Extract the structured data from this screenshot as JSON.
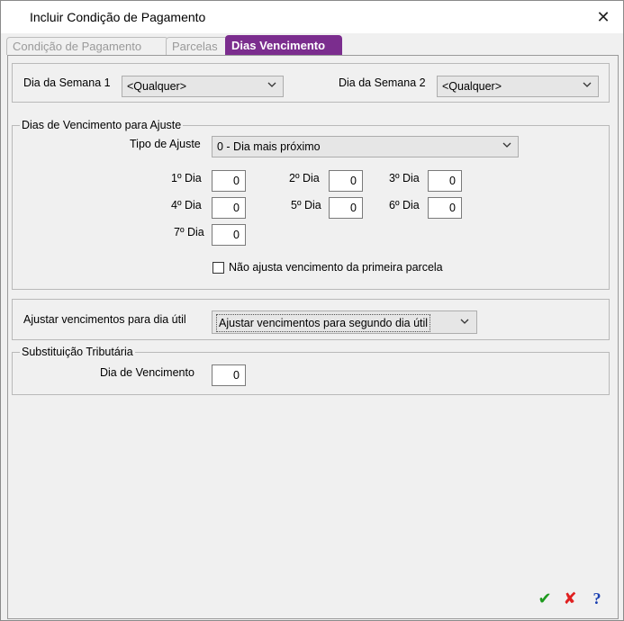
{
  "window": {
    "title": "Incluir Condição de Pagamento",
    "close_glyph": "✕"
  },
  "tabs": [
    {
      "label": "Condição de Pagamento",
      "active": false
    },
    {
      "label": "Parcelas",
      "active": false
    },
    {
      "label": "Dias Vencimento",
      "active": true
    }
  ],
  "weekday": {
    "day1_label": "Dia da Semana 1",
    "day1_value": "<Qualquer>",
    "day2_label": "Dia da Semana 2",
    "day2_value": "<Qualquer>"
  },
  "adjust_days": {
    "legend": "Dias de Vencimento para Ajuste",
    "type_label": "Tipo de Ajuste",
    "type_value": "0 - Dia mais próximo",
    "days": [
      {
        "label": "1º Dia",
        "value": "0"
      },
      {
        "label": "2º Dia",
        "value": "0"
      },
      {
        "label": "3º Dia",
        "value": "0"
      },
      {
        "label": "4º Dia",
        "value": "0"
      },
      {
        "label": "5º Dia",
        "value": "0"
      },
      {
        "label": "6º Dia",
        "value": "0"
      },
      {
        "label": "7º Dia",
        "value": "0"
      }
    ],
    "no_adjust_first_label": "Não ajusta vencimento da primeira parcela",
    "no_adjust_first_checked": false
  },
  "business_day": {
    "label": "Ajustar vencimentos para dia útil",
    "value": "Ajustar vencimentos para segundo dia útil"
  },
  "tax_substitution": {
    "legend": "Substituição Tributária",
    "due_day_label": "Dia de Vencimento",
    "due_day_value": "0"
  },
  "footer": {
    "confirm_icon": "check-icon",
    "cancel_icon": "cross-icon",
    "help_icon": "question-icon",
    "confirm_glyph": "✔",
    "cancel_glyph": "✘",
    "help_glyph": "?",
    "colors": {
      "confirm": "#1e9a1e",
      "cancel": "#e02020",
      "help": "#1a3fb0",
      "tab_active": "#7b2d8e"
    }
  }
}
